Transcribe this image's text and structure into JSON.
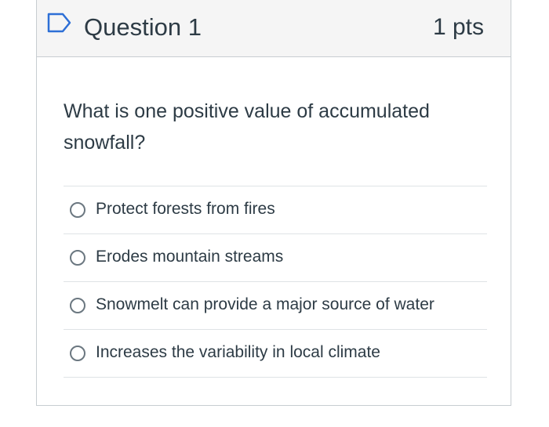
{
  "question": {
    "title": "Question 1",
    "points": "1 pts",
    "flag_icon": "flag-outline-icon",
    "text": "What is one positive value of accumulated snowfall?"
  },
  "answers": [
    {
      "label": "Protect forests from fires",
      "selected": false
    },
    {
      "label": "Erodes mountain streams",
      "selected": false
    },
    {
      "label": "Snowmelt can provide a major source of water",
      "selected": false
    },
    {
      "label": "Increases the variability in local climate",
      "selected": false
    }
  ],
  "colors": {
    "header_bg": "#f5f5f5",
    "border": "#c7cdd1",
    "flag": "#2d6fd6",
    "text": "#2d3b45"
  }
}
